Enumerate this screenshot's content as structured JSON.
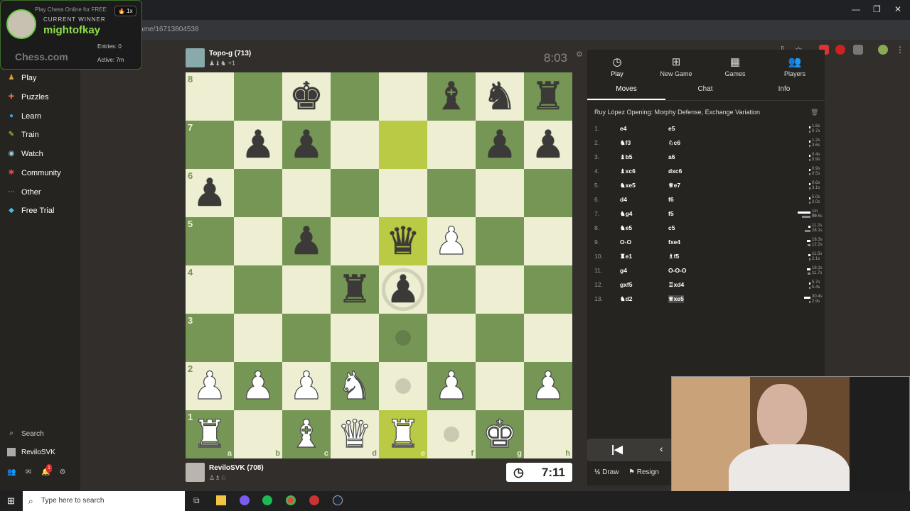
{
  "browser": {
    "url": "chess.com/game/16713804538",
    "window_controls": [
      "—",
      "❐",
      "✕"
    ]
  },
  "overlay": {
    "header": "Play Chess Online for FREE",
    "badge": "🔥 1x",
    "label": "CURRENT WINNER",
    "winner": "mightofkay",
    "entries": "Entries: 0",
    "active": "Active: 7m",
    "logo": "Chess.com"
  },
  "sidebar": {
    "items": [
      {
        "label": "Play",
        "icon": "play-icon",
        "color": "#e8a13a"
      },
      {
        "label": "Puzzles",
        "icon": "puzzle-icon",
        "color": "#e86f3a"
      },
      {
        "label": "Learn",
        "icon": "learn-icon",
        "color": "#3a9fe8"
      },
      {
        "label": "Train",
        "icon": "train-icon",
        "color": "#e8d43a"
      },
      {
        "label": "Watch",
        "icon": "watch-icon",
        "color": "#9fcde8"
      },
      {
        "label": "Community",
        "icon": "community-icon",
        "color": "#e84a3a"
      },
      {
        "label": "Other",
        "icon": "more-icon",
        "color": "#ccc"
      },
      {
        "label": "Free Trial",
        "icon": "diamond-icon",
        "color": "#3ac4e8"
      }
    ],
    "search": "Search",
    "user": "ReviloSVK",
    "notification_count": "1"
  },
  "top_player": {
    "name": "Topo-g (713)",
    "sub": "♟♝♞ +1"
  },
  "bottom_player": {
    "name": "ReviloSVK (708)",
    "sub": "♙♗♘"
  },
  "clocks": {
    "top": "8:03",
    "bottom": "7:11"
  },
  "board": {
    "ranks": [
      "8",
      "7",
      "6",
      "5",
      "4",
      "3",
      "2",
      "1"
    ],
    "files": [
      "a",
      "b",
      "c",
      "d",
      "e",
      "f",
      "g",
      "h"
    ],
    "position": [
      [
        "",
        "",
        "k",
        "",
        "",
        "b",
        "n",
        "r"
      ],
      [
        "",
        "p",
        "p",
        "",
        "",
        "",
        "p",
        "p"
      ],
      [
        "p",
        "",
        "",
        "",
        "",
        "",
        "",
        ""
      ],
      [
        "",
        "",
        "p",
        "",
        "q",
        "P",
        "",
        ""
      ],
      [
        "",
        "",
        "",
        "r",
        "p",
        "",
        "",
        ""
      ],
      [
        "",
        "",
        "",
        "",
        "",
        "",
        "",
        ""
      ],
      [
        "P",
        "P",
        "P",
        "N",
        "",
        "P",
        "",
        "P"
      ],
      [
        "R",
        "",
        "B",
        "Q",
        "R",
        "",
        "K",
        ""
      ]
    ],
    "highlights": [
      "e7",
      "e5",
      "e1"
    ],
    "move_dots": [
      "e3",
      "e2",
      "f1"
    ],
    "capture_ring": [
      "e4"
    ]
  },
  "panel": {
    "tabs": [
      {
        "label": "Play",
        "icon": "clock-icon"
      },
      {
        "label": "New Game",
        "icon": "plus-icon"
      },
      {
        "label": "Games",
        "icon": "board-icon"
      },
      {
        "label": "Players",
        "icon": "players-icon"
      }
    ],
    "subtabs": [
      "Moves",
      "Chat",
      "Info"
    ],
    "opening": "Ruy López Opening: Morphy Defense, Exchange Variation",
    "moves": [
      {
        "n": "1.",
        "w": "e4",
        "b": "e5",
        "t1": "1.6s",
        "t2": "0.7s",
        "p1": 0.02,
        "p2": 0.01
      },
      {
        "n": "2.",
        "w": "♞f3",
        "b": "♘c6",
        "t1": "1.2s",
        "t2": "3.6s",
        "p1": 0.02,
        "p2": 0.04
      },
      {
        "n": "3.",
        "w": "♝b5",
        "b": "a6",
        "t1": "0.4s",
        "t2": "5.9s",
        "p1": 0.01,
        "p2": 0.06
      },
      {
        "n": "4.",
        "w": "♝xc6",
        "b": "dxc6",
        "t1": "0.9s",
        "t2": "0.5s",
        "p1": 0.01,
        "p2": 0.01
      },
      {
        "n": "5.",
        "w": "♞xe5",
        "b": "♕e7",
        "t1": "0.6s",
        "t2": "3.1s",
        "p1": 0.01,
        "p2": 0.03
      },
      {
        "n": "6.",
        "w": "d4",
        "b": "f6",
        "t1": "5.0s",
        "t2": "2.0s",
        "p1": 0.05,
        "p2": 0.02
      },
      {
        "n": "7.",
        "w": "♞g4",
        "b": "f5",
        "t1": "1m 1s",
        "t2": "40.5s",
        "p1": 0.6,
        "p2": 0.4
      },
      {
        "n": "8.",
        "w": "♞e5",
        "b": "c5",
        "t1": "11.2s",
        "t2": "28.1s",
        "p1": 0.11,
        "p2": 0.28
      },
      {
        "n": "9.",
        "w": "O-O",
        "b": "fxe4",
        "t1": "18.3s",
        "t2": "12.2s",
        "p1": 0.18,
        "p2": 0.12
      },
      {
        "n": "10.",
        "w": "♜e1",
        "b": "♗f5",
        "t1": "11.5s",
        "t2": "2.1s",
        "p1": 0.11,
        "p2": 0.02
      },
      {
        "n": "11.",
        "w": "g4",
        "b": "O-O-O",
        "t1": "18.1s",
        "t2": "11.7s",
        "p1": 0.18,
        "p2": 0.12
      },
      {
        "n": "12.",
        "w": "gxf5",
        "b": "♖xd4",
        "t1": "5.7s",
        "t2": "5.4s",
        "p1": 0.06,
        "p2": 0.05
      },
      {
        "n": "13.",
        "w": "♞d2",
        "b": "♕xe5",
        "t1": "30.4s",
        "t2": "2.9s",
        "p1": 0.3,
        "p2": 0.03
      }
    ],
    "controls": {
      "draw": "Draw",
      "resign": "Resign",
      "draw_icon": "½"
    }
  },
  "taskbar": {
    "search": "Type here to search"
  }
}
